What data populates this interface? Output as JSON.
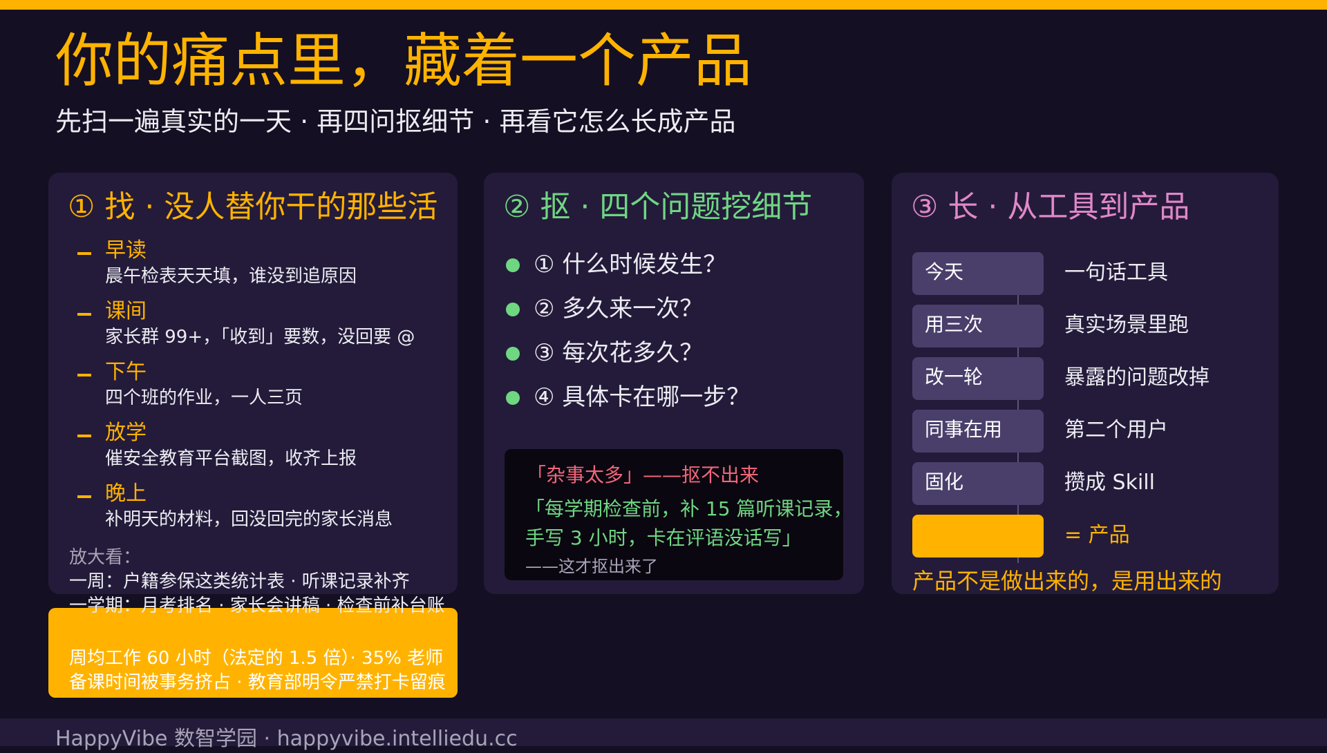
{
  "header": {
    "title": "你的痛点里，藏着一个产品",
    "subtitle": "先扫一遍真实的一天 · 再四问抠细节 · 再看它怎么长成产品"
  },
  "colors": {
    "accent": "#ffb300",
    "background": "#140f22",
    "card": "#241b3a",
    "green": "#6fd682",
    "pink": "#e088c8",
    "red": "#f2667a"
  },
  "find": {
    "heading": "① 找 · 没人替你干的那些活",
    "items": [
      {
        "label": "早读",
        "desc": "晨午检表天天填，谁没到追原因"
      },
      {
        "label": "课间",
        "desc": "家长群 99+，「收到」要数，没回要 @"
      },
      {
        "label": "下午",
        "desc": "四个班的作业，一人三页"
      },
      {
        "label": "放学",
        "desc": "催安全教育平台截图，收齐上报"
      },
      {
        "label": "晚上",
        "desc": "补明天的材料，回没回完的家长消息"
      }
    ],
    "zoom_label": "放大看：",
    "zoom_week": "一周：户籍参保这类统计表 · 听课记录补齐",
    "zoom_term": "一学期：月考排名 · 家长会讲稿 · 检查前补台账",
    "stats_line1": "周均工作 60 小时（法定的 1.5 倍）· 35% 老师",
    "stats_line2": "备课时间被事务挤占 · 教育部明令严禁打卡留痕"
  },
  "dig": {
    "heading": "② 抠 · 四个问题挖细节",
    "questions": [
      "① 什么时候发生？",
      "② 多久来一次？",
      "③ 每次花多久？",
      "④ 具体卡在哪一步？"
    ],
    "bad_example": "「杂事太多」——抠不出来",
    "good_line1": "「每学期检查前，补 15 篇听课记录，",
    "good_line2": "手写 3 小时，卡在评语没话写」",
    "good_note": "——这才抠出来了"
  },
  "grow": {
    "heading": "③ 长 · 从工具到产品",
    "steps": [
      {
        "tag": "今天",
        "desc": "一句话工具"
      },
      {
        "tag": "用三次",
        "desc": "真实场景里跑"
      },
      {
        "tag": "改一轮",
        "desc": "暴露的问题改掉"
      },
      {
        "tag": "同事在用",
        "desc": "第二个用户"
      },
      {
        "tag": "固化",
        "desc": "攒成 Skill"
      },
      {
        "tag": "",
        "desc": "= 产品"
      }
    ],
    "motto": "产品不是做出来的，是用出来的"
  },
  "footer": {
    "text": "HappyVibe 数智学园 · happyvibe.intelliedu.cc"
  }
}
